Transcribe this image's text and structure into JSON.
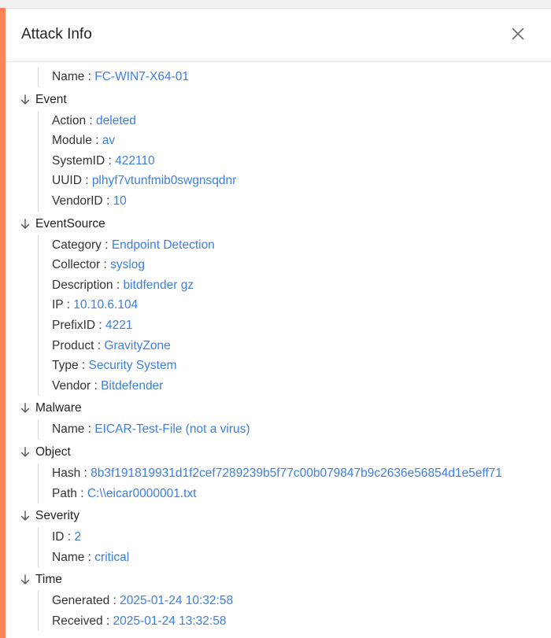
{
  "colors": {
    "accent": "#fd8557",
    "value": "#3d7fe0",
    "divider": "#e3e3e3"
  },
  "modal": {
    "title": "Attack Info",
    "close_icon": "close-icon"
  },
  "groups": [
    {
      "name": "",
      "fields": [
        {
          "key": "Name",
          "value": "FC-WIN7-X64-01"
        }
      ]
    },
    {
      "name": "Event",
      "fields": [
        {
          "key": "Action",
          "value": "deleted"
        },
        {
          "key": "Module",
          "value": "av"
        },
        {
          "key": "SystemID",
          "value": "422110"
        },
        {
          "key": "UUID",
          "value": "plhyf7vtunfmib0swgnsqdnr"
        },
        {
          "key": "VendorID",
          "value": "10"
        }
      ]
    },
    {
      "name": "EventSource",
      "fields": [
        {
          "key": "Category",
          "value": "Endpoint Detection"
        },
        {
          "key": "Collector",
          "value": "syslog"
        },
        {
          "key": "Description",
          "value": "bitdfender gz"
        },
        {
          "key": "IP",
          "value": "10.10.6.104"
        },
        {
          "key": "PrefixID",
          "value": "4221"
        },
        {
          "key": "Product",
          "value": "GravityZone"
        },
        {
          "key": "Type",
          "value": "Security System"
        },
        {
          "key": "Vendor",
          "value": "Bitdefender"
        }
      ]
    },
    {
      "name": "Malware",
      "fields": [
        {
          "key": "Name",
          "value": "EICAR-Test-File (not a virus)"
        }
      ]
    },
    {
      "name": "Object",
      "fields": [
        {
          "key": "Hash",
          "value": "8b3f191819931d1f2cef7289239b5f77c00b079847b9c2636e56854d1e5eff71"
        },
        {
          "key": "Path",
          "value": "C:\\\\eicar0000001.txt"
        }
      ]
    },
    {
      "name": "Severity",
      "fields": [
        {
          "key": "ID",
          "value": "2"
        },
        {
          "key": "Name",
          "value": "critical"
        }
      ]
    },
    {
      "name": "Time",
      "fields": [
        {
          "key": "Generated",
          "value": "2025-01-24 10:32:58"
        },
        {
          "key": "Received",
          "value": "2025-01-24 13:32:58"
        }
      ]
    }
  ]
}
